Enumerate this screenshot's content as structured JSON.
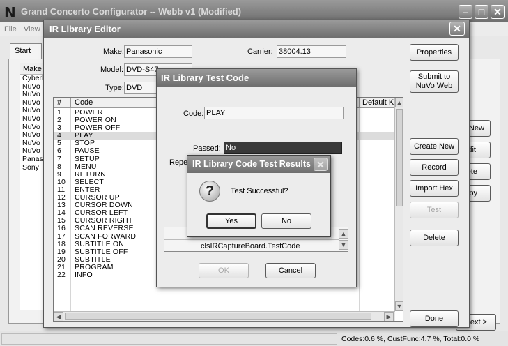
{
  "main_window": {
    "logo": "N",
    "title": "Grand Concerto Configurator -- Webb v1 (Modified)",
    "menu": [
      "File",
      "View"
    ],
    "tab_start": "Start",
    "make_header": "Make",
    "make_items": [
      "Cyberh",
      "NuVo",
      "NuVo",
      "NuVo",
      "NuVo",
      "NuVo",
      "NuVo",
      "NuVo",
      "NuVo",
      "NuVo",
      "Panaso",
      "Sony"
    ],
    "right_buttons": {
      "new": "New",
      "edit": "dit",
      "delete": "lete",
      "copy": "opy"
    },
    "next_button": "Next >",
    "status_text": "Codes:0.6 %, CustFunc:4.7 %, Total:0.0 %"
  },
  "ir_editor": {
    "title": "IR Library Editor",
    "make_label": "Make:",
    "make_value": "Panasonic",
    "model_label": "Model:",
    "model_value": "DVD-S47",
    "type_label": "Type:",
    "type_value": "DVD",
    "carrier_label": "Carrier:",
    "carrier_value": "38004.13",
    "col_num": "#",
    "col_code": "Code",
    "col_default": "Default K",
    "selected_row": 4,
    "codes": [
      {
        "n": "1",
        "code": "POWER"
      },
      {
        "n": "2",
        "code": "POWER ON"
      },
      {
        "n": "3",
        "code": "POWER OFF"
      },
      {
        "n": "4",
        "code": "PLAY"
      },
      {
        "n": "5",
        "code": "STOP"
      },
      {
        "n": "6",
        "code": "PAUSE"
      },
      {
        "n": "7",
        "code": "SETUP"
      },
      {
        "n": "8",
        "code": "MENU"
      },
      {
        "n": "9",
        "code": "RETURN"
      },
      {
        "n": "10",
        "code": "SELECT"
      },
      {
        "n": "11",
        "code": "ENTER"
      },
      {
        "n": "12",
        "code": "CURSOR UP"
      },
      {
        "n": "13",
        "code": "CURSOR DOWN"
      },
      {
        "n": "14",
        "code": "CURSOR LEFT"
      },
      {
        "n": "15",
        "code": "CURSOR RIGHT"
      },
      {
        "n": "16",
        "code": "SCAN REVERSE"
      },
      {
        "n": "17",
        "code": "SCAN FORWARD"
      },
      {
        "n": "18",
        "code": "SUBTITLE ON"
      },
      {
        "n": "19",
        "code": "SUBTITLE OFF"
      },
      {
        "n": "20",
        "code": "SUBTITLE"
      },
      {
        "n": "21",
        "code": "PROGRAM"
      },
      {
        "n": "22",
        "code": "INFO"
      }
    ],
    "buttons": {
      "properties": "Properties",
      "submit_line1": "Submit to",
      "submit_line2": "NuVo Web",
      "create_new": "Create New",
      "record": "Record",
      "import_hex": "Import Hex",
      "test": "Test",
      "delete": "Delete",
      "done": "Done"
    }
  },
  "test_code": {
    "title": "IR Library Test Code",
    "code_label": "Code:",
    "code_value": "PLAY",
    "passed_label": "Passed:",
    "passed_value": "No",
    "repeat_label": "Repe",
    "listbox_item": "clsIRCaptureBoard.TestCode",
    "ok_label": "OK",
    "cancel_label": "Cancel"
  },
  "results": {
    "title": "IR Library Code Test Results",
    "message": "Test Successful?",
    "question_glyph": "?",
    "yes_label": "Yes",
    "no_label": "No"
  },
  "glyphs": {
    "close": "✕",
    "minimize": "–",
    "maximize": "□",
    "up": "▲",
    "down": "▼",
    "left": "◀",
    "right": "▶"
  }
}
